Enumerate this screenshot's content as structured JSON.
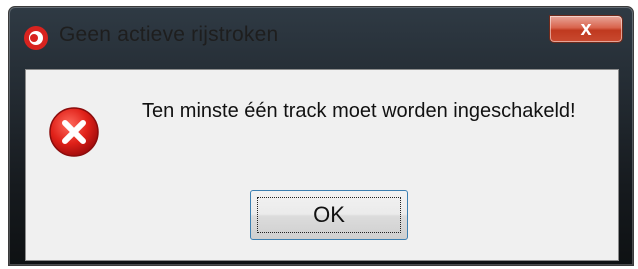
{
  "dialog": {
    "title": "Geen actieve rijstroken",
    "close_label": "x",
    "message": "Ten minste één track moet worden ingeschakeld!",
    "ok_label": "OK"
  },
  "icons": {
    "app": "app-logo-icon",
    "error": "error-icon",
    "close": "close-icon"
  },
  "colors": {
    "close_button": "#c94a30",
    "error_red": "#d81e1e",
    "client_bg": "#f0f0f0",
    "button_focus_border": "#3c7fb1"
  }
}
